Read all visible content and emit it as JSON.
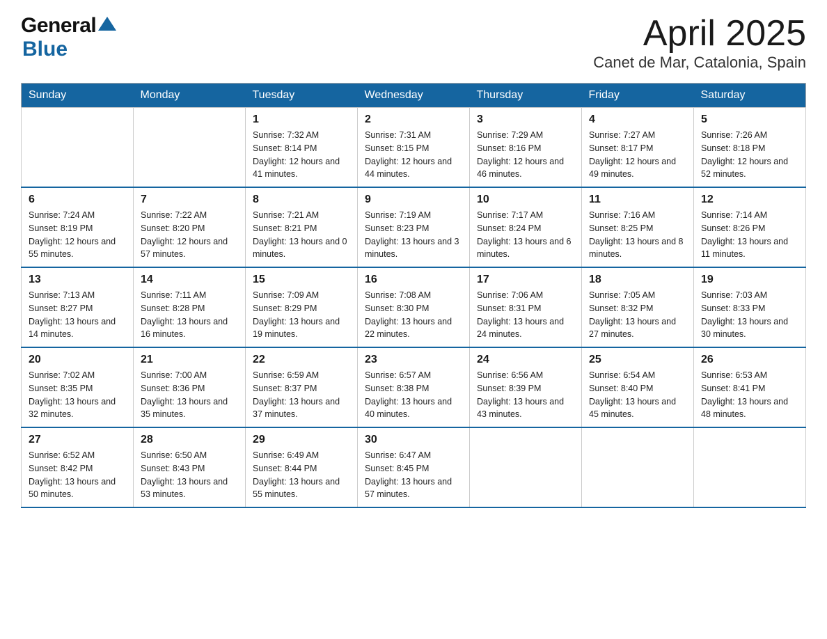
{
  "header": {
    "logo_general": "General",
    "logo_blue": "Blue",
    "month_title": "April 2025",
    "location": "Canet de Mar, Catalonia, Spain"
  },
  "days_of_week": [
    "Sunday",
    "Monday",
    "Tuesday",
    "Wednesday",
    "Thursday",
    "Friday",
    "Saturday"
  ],
  "weeks": [
    [
      {
        "day": "",
        "sunrise": "",
        "sunset": "",
        "daylight": ""
      },
      {
        "day": "",
        "sunrise": "",
        "sunset": "",
        "daylight": ""
      },
      {
        "day": "1",
        "sunrise": "Sunrise: 7:32 AM",
        "sunset": "Sunset: 8:14 PM",
        "daylight": "Daylight: 12 hours and 41 minutes."
      },
      {
        "day": "2",
        "sunrise": "Sunrise: 7:31 AM",
        "sunset": "Sunset: 8:15 PM",
        "daylight": "Daylight: 12 hours and 44 minutes."
      },
      {
        "day": "3",
        "sunrise": "Sunrise: 7:29 AM",
        "sunset": "Sunset: 8:16 PM",
        "daylight": "Daylight: 12 hours and 46 minutes."
      },
      {
        "day": "4",
        "sunrise": "Sunrise: 7:27 AM",
        "sunset": "Sunset: 8:17 PM",
        "daylight": "Daylight: 12 hours and 49 minutes."
      },
      {
        "day": "5",
        "sunrise": "Sunrise: 7:26 AM",
        "sunset": "Sunset: 8:18 PM",
        "daylight": "Daylight: 12 hours and 52 minutes."
      }
    ],
    [
      {
        "day": "6",
        "sunrise": "Sunrise: 7:24 AM",
        "sunset": "Sunset: 8:19 PM",
        "daylight": "Daylight: 12 hours and 55 minutes."
      },
      {
        "day": "7",
        "sunrise": "Sunrise: 7:22 AM",
        "sunset": "Sunset: 8:20 PM",
        "daylight": "Daylight: 12 hours and 57 minutes."
      },
      {
        "day": "8",
        "sunrise": "Sunrise: 7:21 AM",
        "sunset": "Sunset: 8:21 PM",
        "daylight": "Daylight: 13 hours and 0 minutes."
      },
      {
        "day": "9",
        "sunrise": "Sunrise: 7:19 AM",
        "sunset": "Sunset: 8:23 PM",
        "daylight": "Daylight: 13 hours and 3 minutes."
      },
      {
        "day": "10",
        "sunrise": "Sunrise: 7:17 AM",
        "sunset": "Sunset: 8:24 PM",
        "daylight": "Daylight: 13 hours and 6 minutes."
      },
      {
        "day": "11",
        "sunrise": "Sunrise: 7:16 AM",
        "sunset": "Sunset: 8:25 PM",
        "daylight": "Daylight: 13 hours and 8 minutes."
      },
      {
        "day": "12",
        "sunrise": "Sunrise: 7:14 AM",
        "sunset": "Sunset: 8:26 PM",
        "daylight": "Daylight: 13 hours and 11 minutes."
      }
    ],
    [
      {
        "day": "13",
        "sunrise": "Sunrise: 7:13 AM",
        "sunset": "Sunset: 8:27 PM",
        "daylight": "Daylight: 13 hours and 14 minutes."
      },
      {
        "day": "14",
        "sunrise": "Sunrise: 7:11 AM",
        "sunset": "Sunset: 8:28 PM",
        "daylight": "Daylight: 13 hours and 16 minutes."
      },
      {
        "day": "15",
        "sunrise": "Sunrise: 7:09 AM",
        "sunset": "Sunset: 8:29 PM",
        "daylight": "Daylight: 13 hours and 19 minutes."
      },
      {
        "day": "16",
        "sunrise": "Sunrise: 7:08 AM",
        "sunset": "Sunset: 8:30 PM",
        "daylight": "Daylight: 13 hours and 22 minutes."
      },
      {
        "day": "17",
        "sunrise": "Sunrise: 7:06 AM",
        "sunset": "Sunset: 8:31 PM",
        "daylight": "Daylight: 13 hours and 24 minutes."
      },
      {
        "day": "18",
        "sunrise": "Sunrise: 7:05 AM",
        "sunset": "Sunset: 8:32 PM",
        "daylight": "Daylight: 13 hours and 27 minutes."
      },
      {
        "day": "19",
        "sunrise": "Sunrise: 7:03 AM",
        "sunset": "Sunset: 8:33 PM",
        "daylight": "Daylight: 13 hours and 30 minutes."
      }
    ],
    [
      {
        "day": "20",
        "sunrise": "Sunrise: 7:02 AM",
        "sunset": "Sunset: 8:35 PM",
        "daylight": "Daylight: 13 hours and 32 minutes."
      },
      {
        "day": "21",
        "sunrise": "Sunrise: 7:00 AM",
        "sunset": "Sunset: 8:36 PM",
        "daylight": "Daylight: 13 hours and 35 minutes."
      },
      {
        "day": "22",
        "sunrise": "Sunrise: 6:59 AM",
        "sunset": "Sunset: 8:37 PM",
        "daylight": "Daylight: 13 hours and 37 minutes."
      },
      {
        "day": "23",
        "sunrise": "Sunrise: 6:57 AM",
        "sunset": "Sunset: 8:38 PM",
        "daylight": "Daylight: 13 hours and 40 minutes."
      },
      {
        "day": "24",
        "sunrise": "Sunrise: 6:56 AM",
        "sunset": "Sunset: 8:39 PM",
        "daylight": "Daylight: 13 hours and 43 minutes."
      },
      {
        "day": "25",
        "sunrise": "Sunrise: 6:54 AM",
        "sunset": "Sunset: 8:40 PM",
        "daylight": "Daylight: 13 hours and 45 minutes."
      },
      {
        "day": "26",
        "sunrise": "Sunrise: 6:53 AM",
        "sunset": "Sunset: 8:41 PM",
        "daylight": "Daylight: 13 hours and 48 minutes."
      }
    ],
    [
      {
        "day": "27",
        "sunrise": "Sunrise: 6:52 AM",
        "sunset": "Sunset: 8:42 PM",
        "daylight": "Daylight: 13 hours and 50 minutes."
      },
      {
        "day": "28",
        "sunrise": "Sunrise: 6:50 AM",
        "sunset": "Sunset: 8:43 PM",
        "daylight": "Daylight: 13 hours and 53 minutes."
      },
      {
        "day": "29",
        "sunrise": "Sunrise: 6:49 AM",
        "sunset": "Sunset: 8:44 PM",
        "daylight": "Daylight: 13 hours and 55 minutes."
      },
      {
        "day": "30",
        "sunrise": "Sunrise: 6:47 AM",
        "sunset": "Sunset: 8:45 PM",
        "daylight": "Daylight: 13 hours and 57 minutes."
      },
      {
        "day": "",
        "sunrise": "",
        "sunset": "",
        "daylight": ""
      },
      {
        "day": "",
        "sunrise": "",
        "sunset": "",
        "daylight": ""
      },
      {
        "day": "",
        "sunrise": "",
        "sunset": "",
        "daylight": ""
      }
    ]
  ]
}
